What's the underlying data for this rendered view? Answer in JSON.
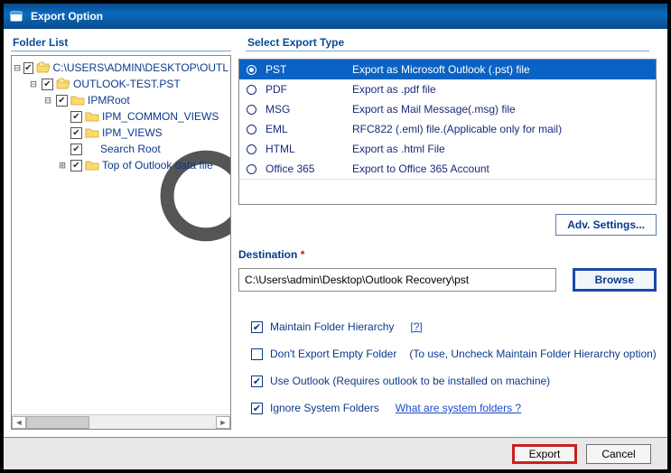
{
  "window": {
    "title": "Export Option"
  },
  "panes": {
    "folder_list": "Folder List",
    "export_type": "Select Export Type"
  },
  "tree": {
    "root": "C:\\USERS\\ADMIN\\DESKTOP\\OUTL",
    "lvl1": "OUTLOOK-TEST.PST",
    "lvl2": "IPMRoot",
    "children": {
      "a": "IPM_COMMON_VIEWS",
      "b": "IPM_VIEWS",
      "c": "Search Root",
      "d": "Top of Outlook data file"
    }
  },
  "types": [
    {
      "code": "PST",
      "desc": "Export as Microsoft Outlook (.pst) file",
      "selected": true
    },
    {
      "code": "PDF",
      "desc": "Export as .pdf file"
    },
    {
      "code": "MSG",
      "desc": "Export as Mail Message(.msg) file"
    },
    {
      "code": "EML",
      "desc": "RFC822 (.eml) file.(Applicable only for mail)"
    },
    {
      "code": "HTML",
      "desc": "Export as .html File"
    },
    {
      "code": "Office 365",
      "desc": "Export to Office 365 Account"
    }
  ],
  "adv_settings": "Adv. Settings...",
  "destination": {
    "label": "Destination",
    "req": "*",
    "value": "C:\\Users\\admin\\Desktop\\Outlook Recovery\\pst",
    "browse": "Browse"
  },
  "options": {
    "maintain": "Maintain Folder Hierarchy",
    "help_q": "[?]",
    "dont_export": "Don't Export Empty Folder",
    "dont_export_hint": "(To use, Uncheck Maintain Folder Hierarchy option)",
    "use_outlook": "Use Outlook (Requires outlook to be installed on machine)",
    "ignore_sys": "Ignore System Folders",
    "what_sys": "What are system folders ?"
  },
  "footer": {
    "export": "Export",
    "cancel": "Cancel"
  }
}
